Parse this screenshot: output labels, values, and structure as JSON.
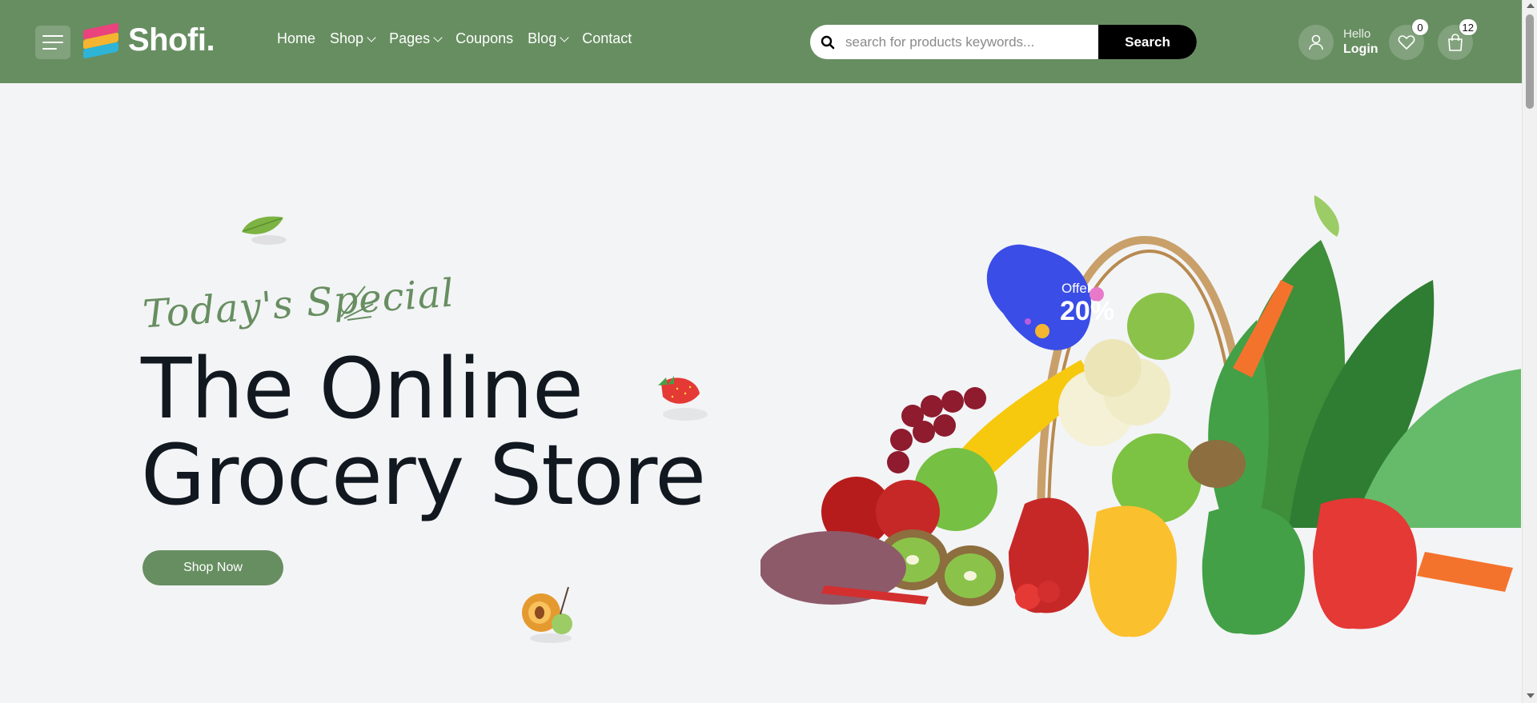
{
  "brand": {
    "name": "Shofi."
  },
  "nav": {
    "items": [
      {
        "label": "Home",
        "dropdown": false
      },
      {
        "label": "Shop",
        "dropdown": true
      },
      {
        "label": "Pages",
        "dropdown": true
      },
      {
        "label": "Coupons",
        "dropdown": false
      },
      {
        "label": "Blog",
        "dropdown": true
      },
      {
        "label": "Contact",
        "dropdown": false
      }
    ]
  },
  "search": {
    "placeholder": "search for products keywords...",
    "button_label": "Search"
  },
  "account": {
    "greeting": "Hello",
    "action": "Login"
  },
  "wishlist": {
    "count": "0"
  },
  "cart": {
    "count": "12"
  },
  "hero": {
    "script": "Today's Special",
    "title_line1": "The Online",
    "title_line2": "Grocery Store",
    "cta": "Shop Now",
    "offer_label": "Offer",
    "offer_value": "20%"
  },
  "colors": {
    "header": "#678e61",
    "background": "#f3f4f6",
    "title": "#121820",
    "offer": "#3a4de6"
  }
}
